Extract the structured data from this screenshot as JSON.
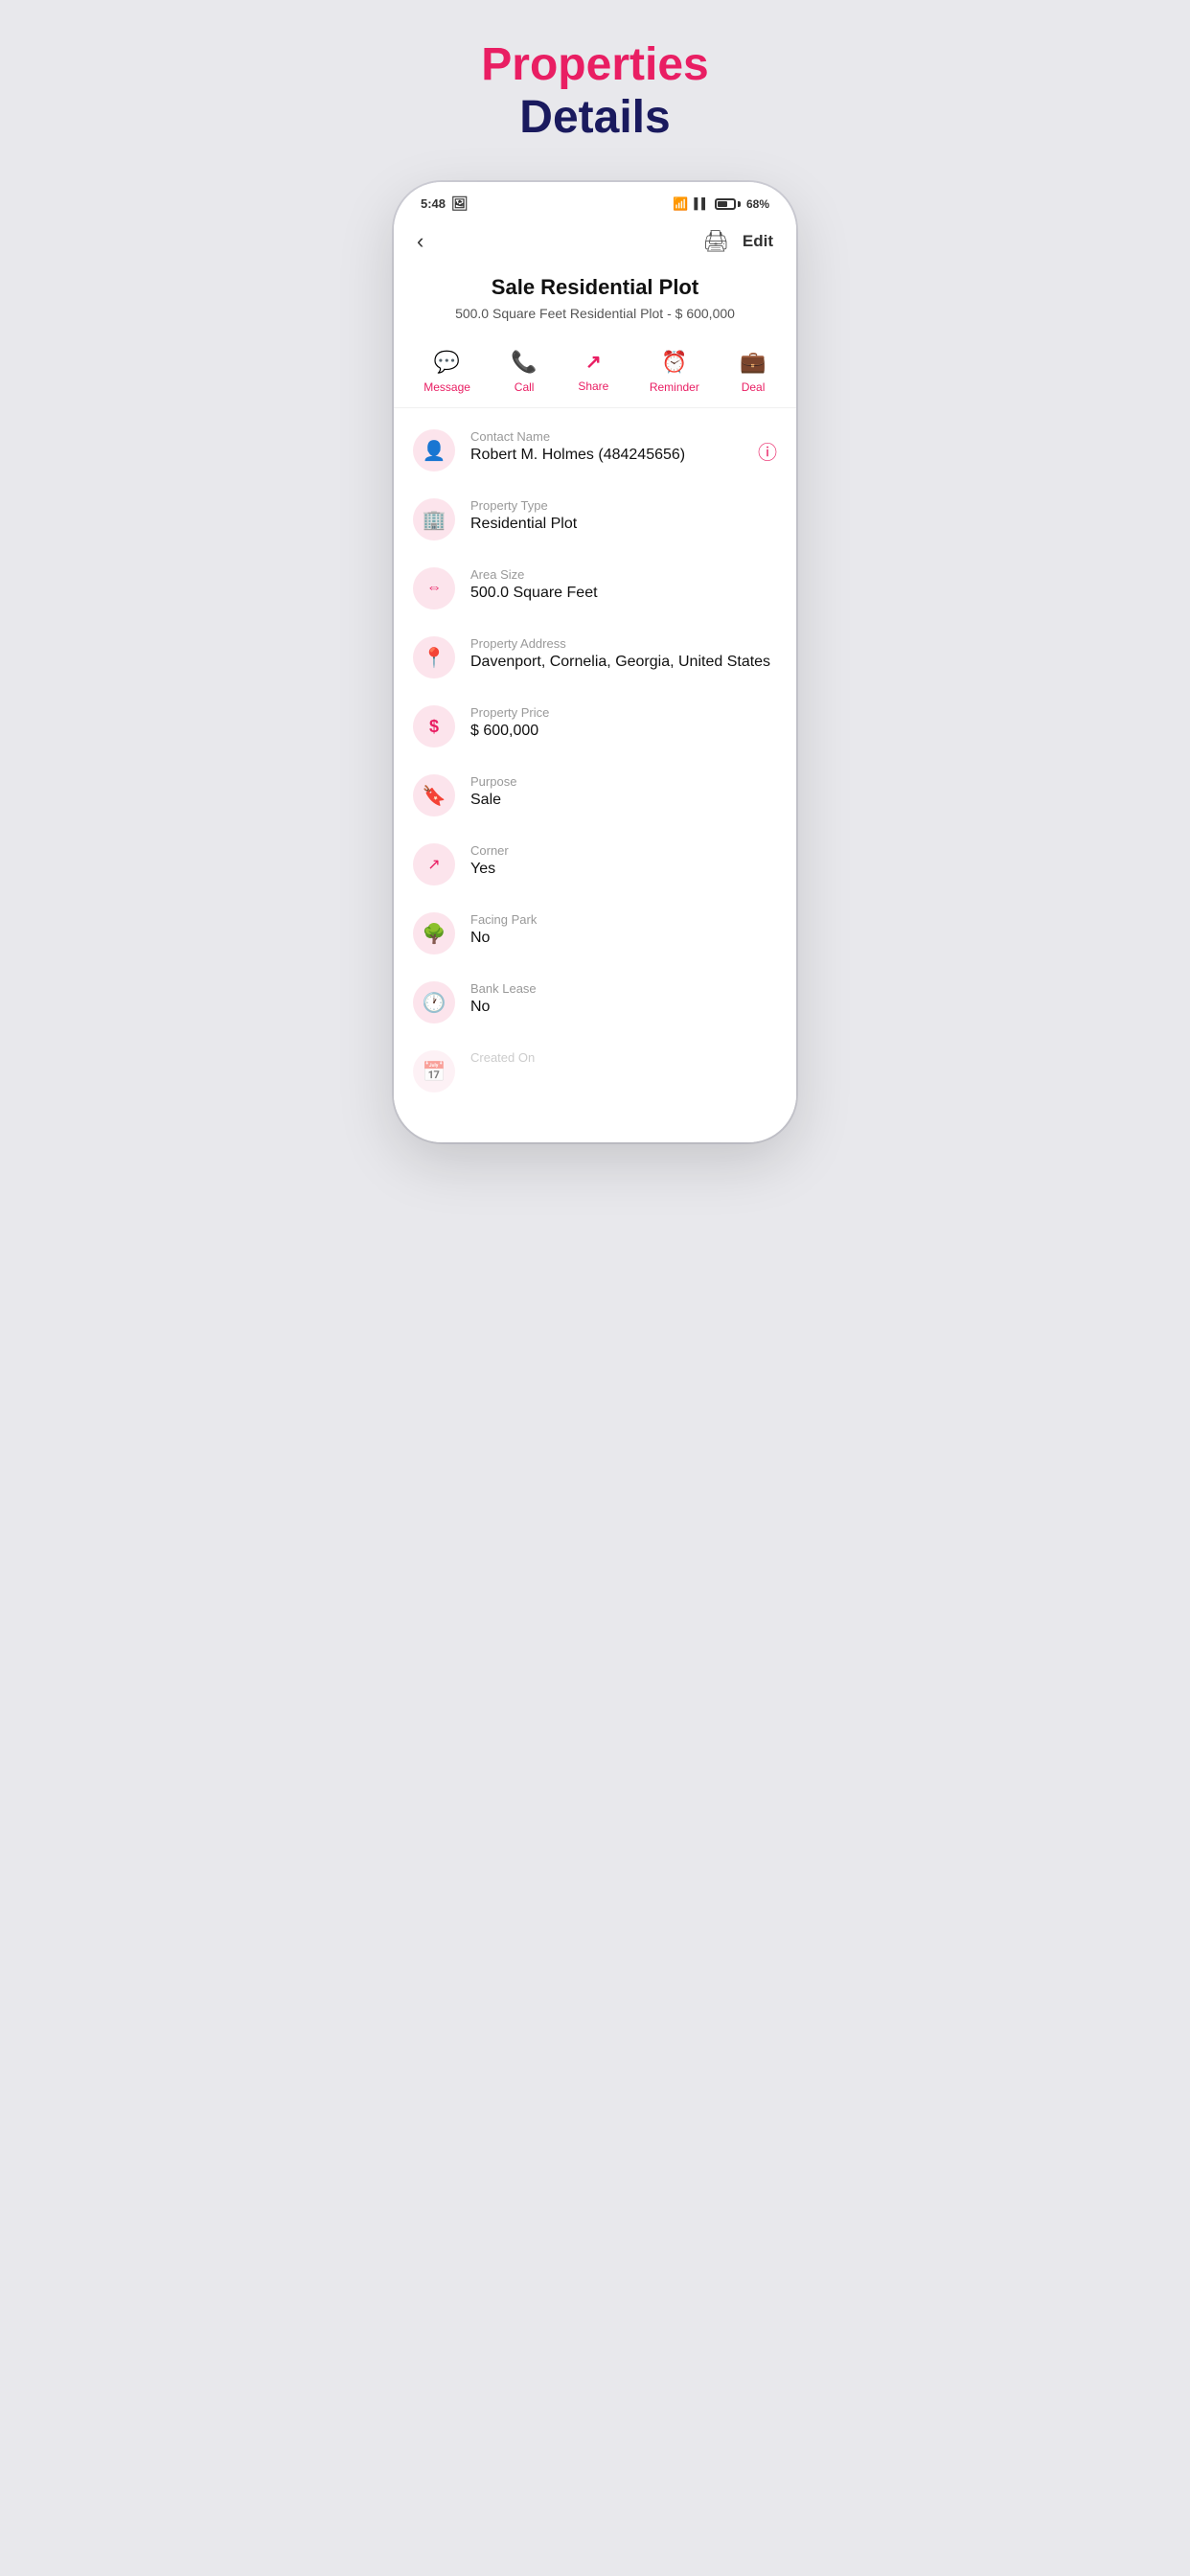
{
  "page": {
    "title_line1": "Properties",
    "title_line2": "Details"
  },
  "status_bar": {
    "time": "5:48",
    "battery_percent": "68%"
  },
  "nav": {
    "edit_label": "Edit"
  },
  "property": {
    "title": "Sale Residential Plot",
    "subtitle": "500.0 Square Feet Residential Plot - $ 600,000"
  },
  "actions": [
    {
      "label": "Message",
      "icon": "💬"
    },
    {
      "label": "Call",
      "icon": "📞"
    },
    {
      "label": "Share",
      "icon": "↗"
    },
    {
      "label": "Reminder",
      "icon": "⏰"
    },
    {
      "label": "Deal",
      "icon": "💼"
    }
  ],
  "details": [
    {
      "label": "Contact Name",
      "value": "Robert M. Holmes  (484245656)",
      "icon": "👤",
      "has_info": true
    },
    {
      "label": "Property Type",
      "value": "Residential Plot",
      "icon": "🏢",
      "has_info": false
    },
    {
      "label": "Area Size",
      "value": "500.0 Square Feet",
      "icon": "⇔",
      "has_info": false
    },
    {
      "label": "Property Address",
      "value": "Davenport, Cornelia, Georgia, United States",
      "icon": "📍",
      "has_info": false
    },
    {
      "label": "Property Price",
      "value": "$ 600,000",
      "icon": "$",
      "has_info": false
    },
    {
      "label": "Purpose",
      "value": "Sale",
      "icon": "🔖",
      "has_info": false
    },
    {
      "label": "Corner",
      "value": "Yes",
      "icon": "↗",
      "has_info": false
    },
    {
      "label": "Facing Park",
      "value": "No",
      "icon": "🌳",
      "has_info": false
    },
    {
      "label": "Bank Lease",
      "value": "No",
      "icon": "🕐",
      "has_info": false
    },
    {
      "label": "Created On",
      "value": "",
      "icon": "📅",
      "has_info": false
    }
  ],
  "colors": {
    "accent": "#e91e63",
    "dark_blue": "#1a1a5e"
  }
}
